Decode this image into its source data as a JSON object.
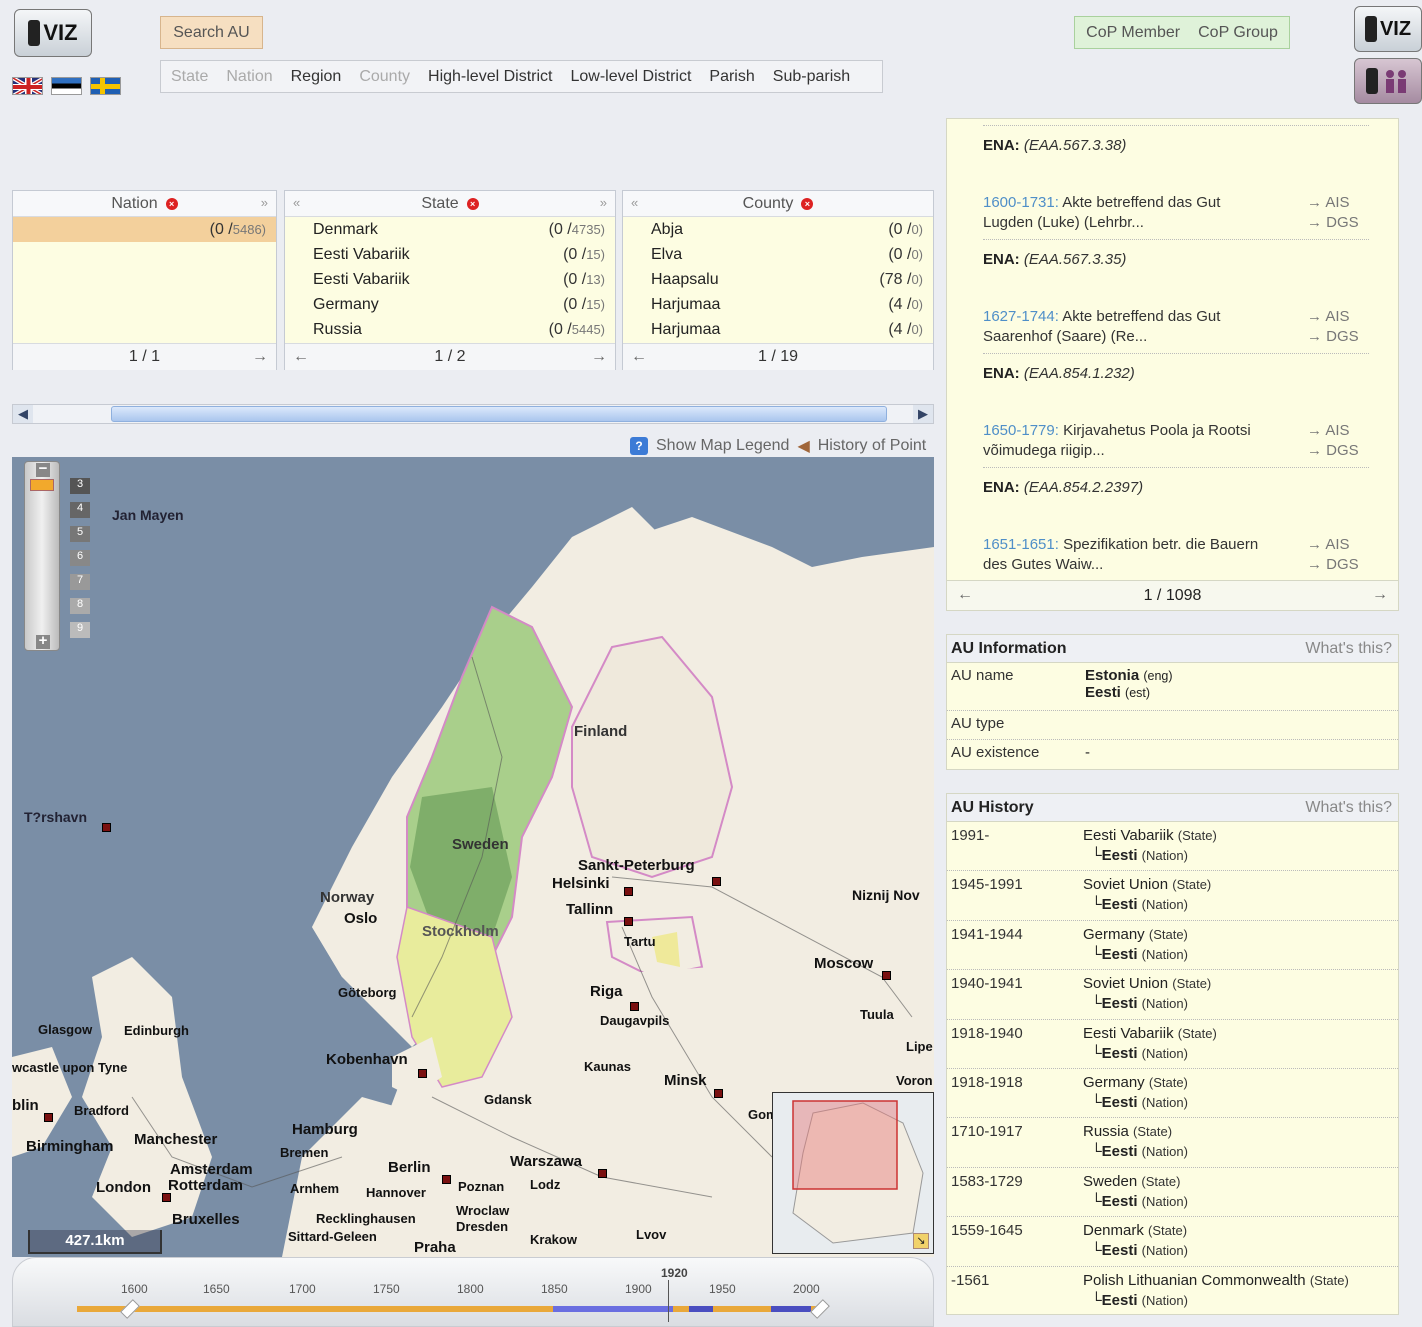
{
  "header": {
    "logo_text": "VIZ",
    "search_button": "Search AU",
    "level_tabs": [
      {
        "label": "State",
        "active": false
      },
      {
        "label": "Nation",
        "active": false
      },
      {
        "label": "Region",
        "active": true
      },
      {
        "label": "County",
        "active": false
      },
      {
        "label": "High-level District",
        "active": true
      },
      {
        "label": "Low-level District",
        "active": true
      },
      {
        "label": "Parish",
        "active": true
      },
      {
        "label": "Sub-parish",
        "active": true
      }
    ],
    "cop_member": "CoP Member",
    "cop_group": "CoP Group",
    "flags": [
      "flag-uk-icon",
      "flag-estonia-icon",
      "flag-sweden-icon"
    ]
  },
  "columns": {
    "nation": {
      "title": "Nation",
      "rows": [
        {
          "name": "",
          "count": "(0 /",
          "total": "5486)"
        }
      ],
      "pager": "1 / 1"
    },
    "state": {
      "title": "State",
      "rows": [
        {
          "name": "Denmark",
          "count": "(0 /",
          "total": "4735)"
        },
        {
          "name": "Eesti Vabariik",
          "count": "(0 /",
          "total": "15)"
        },
        {
          "name": "Eesti Vabariik",
          "count": "(0 /",
          "total": "13)"
        },
        {
          "name": "Germany",
          "count": "(0 /",
          "total": "15)"
        },
        {
          "name": "Russia",
          "count": "(0 /",
          "total": "5445)"
        }
      ],
      "pager": "1 / 2"
    },
    "county": {
      "title": "County",
      "rows": [
        {
          "name": "Abja",
          "count": "(0 /",
          "total": "0)"
        },
        {
          "name": "Elva",
          "count": "(0 /",
          "total": "0)"
        },
        {
          "name": "Haapsalu",
          "count": "(78 /",
          "total": "0)"
        },
        {
          "name": "Harjumaa",
          "count": "(4 /",
          "total": "0)"
        },
        {
          "name": "Harjumaa",
          "count": "(4 /",
          "total": "0)"
        }
      ],
      "pager": "1 / 19"
    }
  },
  "map_tools": {
    "legend": "Show Map Legend",
    "history": "History of Point"
  },
  "map": {
    "zoom_levels": [
      "3",
      "4",
      "5",
      "6",
      "7",
      "8",
      "9"
    ],
    "scale": "427.1km",
    "labels": {
      "jan_mayen": "Jan Mayen",
      "torshavn": "T?rshavn",
      "finland": "Finland",
      "sweden": "Sweden",
      "norway": "Norway",
      "oslo": "Oslo",
      "stockholm": "Stockholm",
      "goteborg": "Göteborg",
      "sankt": "Sankt-Peterburg",
      "helsinki": "Helsinki",
      "tallinn": "Tallinn",
      "tartu": "Tartu",
      "riga": "Riga",
      "daugavpils": "Daugavpils",
      "moscow": "Moscow",
      "niznij": "Niznij Nov",
      "tuula": "Tuula",
      "lipe": "Lipe",
      "voron": "Voron",
      "glasgow": "Glasgow",
      "edinburgh": "Edinburgh",
      "newcastle": "wcastle upon Tyne",
      "dublin": "blin",
      "bradford": "Bradford",
      "birmingham": "Birmingham",
      "manchester": "Manchester",
      "london": "London",
      "amsterdam": "Amsterdam",
      "rotterdam": "Rotterdam",
      "bruxelles": "Bruxelles",
      "kobenhavn": "Kobenhavn",
      "kaunas": "Kaunas",
      "minsk": "Minsk",
      "gdansk": "Gdansk",
      "hamburg": "Hamburg",
      "bremen": "Bremen",
      "berlin": "Berlin",
      "warszawa": "Warszawa",
      "arnhem": "Arnhem",
      "hannover": "Hannover",
      "poznan": "Poznan",
      "lodz": "Lodz",
      "wroclaw": "Wroclaw",
      "dresden": "Dresden",
      "recklinghausen": "Recklinghausen",
      "sittard": "Sittard-Geleen",
      "praha": "Praha",
      "krakow": "Krakow",
      "lvov": "Lvov",
      "gom": "Gom"
    }
  },
  "timeline": {
    "marker_year": "1920",
    "ticks": [
      "1600",
      "1650",
      "1700",
      "1750",
      "1800",
      "1850",
      "1900",
      "1950",
      "2000"
    ]
  },
  "documents": {
    "items": [
      {
        "ena_label": "ENA:",
        "ena_ref": "(EAA.567.3.38)"
      },
      {
        "years": "1600-1731:",
        "title": "Akte betreffend das Gut Lugden (Luke) (Lehrbr...",
        "ena_label": "ENA:",
        "ena_ref": "(EAA.567.3.35)"
      },
      {
        "years": "1627-1744:",
        "title": "Akte betreffend das Gut Saarenhof (Saare) (Re...",
        "ena_label": "ENA:",
        "ena_ref": "(EAA.854.1.232)"
      },
      {
        "years": "1650-1779:",
        "title": "Kirjavahetus Poola ja Rootsi võimudega riigip...",
        "ena_label": "ENA:",
        "ena_ref": "(EAA.854.2.2397)"
      },
      {
        "years": "1651-1651:",
        "title": "Spezifikation betr. die Bauern des Gutes Waiw..."
      }
    ],
    "link_ais": "→ AIS",
    "link_dgs": "→ DGS",
    "pager": "1 / 1098"
  },
  "au_info": {
    "title": "AU Information",
    "whats_this": "What's this?",
    "name_label": "AU name",
    "name_eng": "Estonia",
    "name_eng_tag": "(eng)",
    "name_est": "Eesti",
    "name_est_tag": "(est)",
    "type_label": "AU type",
    "type_value": "",
    "existence_label": "AU existence",
    "existence_value": "-"
  },
  "au_history": {
    "title": "AU History",
    "whats_this": "What's this?",
    "rows": [
      {
        "period": "1991-",
        "state": "Eesti Vabariik",
        "state_tag": "(State)",
        "nation": "Eesti",
        "nation_tag": "(Nation)"
      },
      {
        "period": "1945-1991",
        "state": "Soviet Union",
        "state_tag": "(State)",
        "nation": "Eesti",
        "nation_tag": "(Nation)"
      },
      {
        "period": "1941-1944",
        "state": "Germany",
        "state_tag": "(State)",
        "nation": "Eesti",
        "nation_tag": "(Nation)"
      },
      {
        "period": "1940-1941",
        "state": "Soviet Union",
        "state_tag": "(State)",
        "nation": "Eesti",
        "nation_tag": "(Nation)"
      },
      {
        "period": "1918-1940",
        "state": "Eesti Vabariik",
        "state_tag": "(State)",
        "nation": "Eesti",
        "nation_tag": "(Nation)"
      },
      {
        "period": "1918-1918",
        "state": "Germany",
        "state_tag": "(State)",
        "nation": "Eesti",
        "nation_tag": "(Nation)"
      },
      {
        "period": "1710-1917",
        "state": "Russia",
        "state_tag": "(State)",
        "nation": "Eesti",
        "nation_tag": "(Nation)"
      },
      {
        "period": "1583-1729",
        "state": "Sweden",
        "state_tag": "(State)",
        "nation": "Eesti",
        "nation_tag": "(Nation)"
      },
      {
        "period": "1559-1645",
        "state": "Denmark",
        "state_tag": "(State)",
        "nation": "Eesti",
        "nation_tag": "(Nation)"
      },
      {
        "period": "-1561",
        "state": "Polish Lithuanian Commonwealth",
        "state_tag": "(State)",
        "nation": "Eesti",
        "nation_tag": "(Nation)"
      }
    ]
  }
}
